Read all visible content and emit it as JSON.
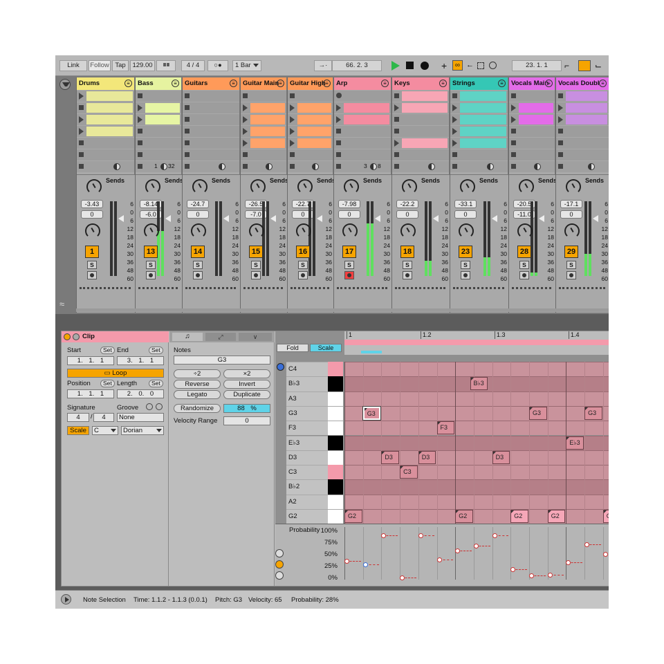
{
  "toolbar": {
    "link": "Link",
    "follow": "Follow",
    "tap": "Tap",
    "tempo": "129.00",
    "meter_bars": "IIII IIII",
    "signature": "4 / 4",
    "metro": "○●",
    "quant": "1 Bar",
    "position": "66.  2.  3",
    "end_position": "23.  1.  1"
  },
  "tracks": [
    {
      "name": "Drums",
      "color": "#f3e77a",
      "sends": "Sends",
      "vol": "-3.43",
      "pan": "0",
      "num": "1",
      "meter": 0,
      "clips": [
        1,
        0,
        1,
        1,
        0,
        0
      ],
      "hatch": true,
      "clip_color": "#e8e89a"
    },
    {
      "name": "Bass",
      "color": "#e6f3a0",
      "sends": "Sends",
      "vol": "-8.14",
      "pan": "-6.0",
      "num": "13",
      "meter": 60,
      "clips": [
        0,
        1,
        1,
        0,
        0,
        0
      ],
      "hatch": false,
      "clip_color": "#e6f5a4",
      "extra": "1",
      "extra2": "32"
    },
    {
      "name": "Guitars",
      "color": "#ff9a59",
      "sends": "Sends",
      "vol": "-24.7",
      "pan": "0",
      "num": "14",
      "meter": 0,
      "clips": [
        0,
        0,
        0,
        0,
        0,
        0
      ],
      "hatch": false,
      "clip_color": "#ff9a59"
    },
    {
      "name": "Guitar Main",
      "color": "#ff9a59",
      "sends": "Sends",
      "vol": "-26.5",
      "pan": "-7.0",
      "num": "15",
      "meter": 0,
      "clips": [
        0,
        1,
        1,
        1,
        1,
        0
      ],
      "hatch": false,
      "clip_color": "#ffa36a"
    },
    {
      "name": "Guitar High",
      "color": "#ff9a59",
      "sends": "Sends",
      "vol": "-22.7",
      "pan": "0",
      "num": "16",
      "meter": 0,
      "clips": [
        0,
        1,
        1,
        1,
        1,
        0
      ],
      "hatch": false,
      "clip_color": "#ffa36a"
    },
    {
      "name": "Arp",
      "color": "#f48ca0",
      "sends": "Sends",
      "vol": "-7.98",
      "pan": "0",
      "num": "17",
      "meter": 70,
      "clips": [
        0,
        1,
        1,
        0,
        0,
        0
      ],
      "hatch": false,
      "clip_color": "#f48ca0",
      "extra": "3",
      "extra2": "8"
    },
    {
      "name": "Keys",
      "color": "#f48ca0",
      "sends": "Sends",
      "vol": "-22.2",
      "pan": "0",
      "num": "18",
      "meter": 20,
      "clips": [
        0,
        1,
        0,
        0,
        1,
        0
      ],
      "hatch": true,
      "clip_color": "#f7a6b5"
    },
    {
      "name": "Strings",
      "color": "#35c7b5",
      "sends": "Sends",
      "vol": "-33.1",
      "pan": "0",
      "num": "23",
      "meter": 25,
      "clips": [
        0,
        1,
        1,
        1,
        1,
        0
      ],
      "hatch": true,
      "clip_color": "#5fd3c5"
    },
    {
      "name": "Vocals Main",
      "color": "#e36ce8",
      "sends": "Sends",
      "vol": "-20.5",
      "pan": "-11.0",
      "num": "28",
      "meter": 5,
      "clips": [
        0,
        1,
        1,
        0,
        0,
        0
      ],
      "hatch": false,
      "clip_color": "#e36ce8"
    },
    {
      "name": "Vocals Doubl",
      "color": "#e36ce8",
      "sends": "Sends",
      "vol": "-17.1",
      "pan": "0",
      "num": "29",
      "meter": 30,
      "clips": [
        0,
        1,
        1,
        0,
        0,
        0
      ],
      "hatch": true,
      "clip_color": "#c88fe0"
    }
  ],
  "meter_scale": [
    "6",
    "0",
    "6",
    "12",
    "18",
    "24",
    "30",
    "36",
    "48",
    "60"
  ],
  "solo_label": "S",
  "clip": {
    "title": "Clip",
    "start_label": "Start",
    "set": "Set",
    "end_label": "End",
    "start": "1. 1. 1",
    "end": "3. 1. 1",
    "loop": "Loop",
    "position_label": "Position",
    "length_label": "Length",
    "position": "1. 1. 1",
    "length": "2. 0. 0",
    "signature_label": "Signature",
    "groove_label": "Groove",
    "sig_num": "4",
    "sig_den": "4",
    "groove": "None",
    "scale_btn": "Scale",
    "root": "C",
    "mode": "Dorian"
  },
  "notes_panel": {
    "title": "Notes",
    "name": "G3",
    "half": "÷2",
    "double": "×2",
    "reverse": "Reverse",
    "invert": "Invert",
    "legato": "Legato",
    "duplicate": "Duplicate",
    "randomize": "Randomize",
    "randomize_pct": "88 %",
    "vel_range_label": "Velocity Range",
    "vel_range": "0"
  },
  "editor": {
    "fold": "Fold",
    "scale": "Scale",
    "ruler": [
      "1",
      "1.2",
      "1.3",
      "1.4"
    ],
    "pitches": [
      "C4",
      "B♭3",
      "A3",
      "G3",
      "F3",
      "E♭3",
      "D3",
      "C3",
      "B♭2",
      "A2",
      "G2"
    ],
    "notes": [
      {
        "label": "B♭3",
        "row": 1,
        "beat": 6.8
      },
      {
        "label": "G3",
        "row": 3,
        "beat": 1.0,
        "sel": true
      },
      {
        "label": "G3",
        "row": 3,
        "beat": 10.0
      },
      {
        "label": "G3",
        "row": 3,
        "beat": 13.0
      },
      {
        "label": "F3",
        "row": 4,
        "beat": 5.0
      },
      {
        "label": "E♭3",
        "row": 5,
        "beat": 12.0
      },
      {
        "label": "D3",
        "row": 6,
        "beat": 2.0
      },
      {
        "label": "D3",
        "row": 6,
        "beat": 4.0
      },
      {
        "label": "D3",
        "row": 6,
        "beat": 8.0
      },
      {
        "label": "C3",
        "row": 7,
        "beat": 3.0
      },
      {
        "label": "G2",
        "row": 10,
        "beat": 0.0
      },
      {
        "label": "G2",
        "row": 10,
        "beat": 6.0
      },
      {
        "label": "G2",
        "row": 10,
        "beat": 9.0
      },
      {
        "label": "G2",
        "row": 10,
        "beat": 11.0
      },
      {
        "label": "G",
        "row": 10,
        "beat": 14.0
      }
    ],
    "prob_label": "Probability",
    "prob_ticks": [
      "100%",
      "75%",
      "50%",
      "25%",
      "0%"
    ],
    "prob_points": [
      {
        "beat": 0,
        "p": 0.35
      },
      {
        "beat": 1,
        "p": 0.28,
        "sel": true
      },
      {
        "beat": 2,
        "p": 0.9
      },
      {
        "beat": 3,
        "p": 0.0
      },
      {
        "beat": 4,
        "p": 0.9
      },
      {
        "beat": 5,
        "p": 0.38
      },
      {
        "beat": 6,
        "p": 0.58
      },
      {
        "beat": 7,
        "p": 0.68
      },
      {
        "beat": 8,
        "p": 0.9
      },
      {
        "beat": 9,
        "p": 0.18
      },
      {
        "beat": 10,
        "p": 0.05
      },
      {
        "beat": 11,
        "p": 0.06
      },
      {
        "beat": 12,
        "p": 0.32
      },
      {
        "beat": 13,
        "p": 0.7
      },
      {
        "beat": 14,
        "p": 0.5
      }
    ]
  },
  "status": {
    "selection": "Note Selection",
    "time": "Time: 1.1.2 - 1.1.3 (0.0.1)",
    "pitch": "Pitch: G3",
    "velocity": "Velocity: 65",
    "probability": "Probability: 28%"
  }
}
